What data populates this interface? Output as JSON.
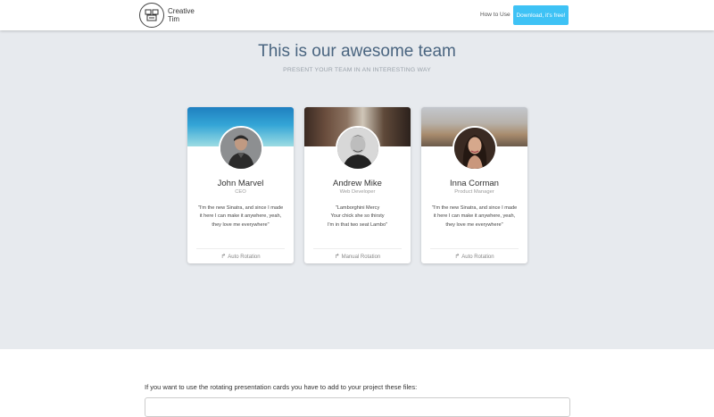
{
  "navbar": {
    "brand_line1": "Creative",
    "brand_line2": "Tim",
    "how_to_use": "How to Use",
    "download": "Download, it's free!"
  },
  "hero": {
    "title": "This is our awesome team",
    "subtitle": "PRESENT YOUR TEAM IN AN INTERESTING WAY"
  },
  "cards": [
    {
      "name": "John Marvel",
      "role": "CEO",
      "quote": [
        "\"I'm the new Sinatra, and since I made",
        "it here I can make it anywhere, yeah,",
        "they love me everywhere\""
      ],
      "rotate": "Auto Rotation"
    },
    {
      "name": "Andrew Mike",
      "role": "Web Developer",
      "quote": [
        "\"Lamborghini Mercy",
        "Your chick she so thirsty",
        "I'm in that two seat Lambo\""
      ],
      "rotate": "Manual Rotation"
    },
    {
      "name": "Inna Corman",
      "role": "Product Manager",
      "quote": [
        "\"I'm the new Sinatra, and since I made",
        "it here I can make it anywhere, yeah,",
        "they love me everywhere\""
      ],
      "rotate": "Auto Rotation"
    }
  ],
  "instructions": {
    "text": "If you want to use the rotating presentation cards you have to add to your project these files:"
  },
  "icons": {
    "logo": "creative-tim-logo",
    "rotate": "share-arrow-icon"
  }
}
